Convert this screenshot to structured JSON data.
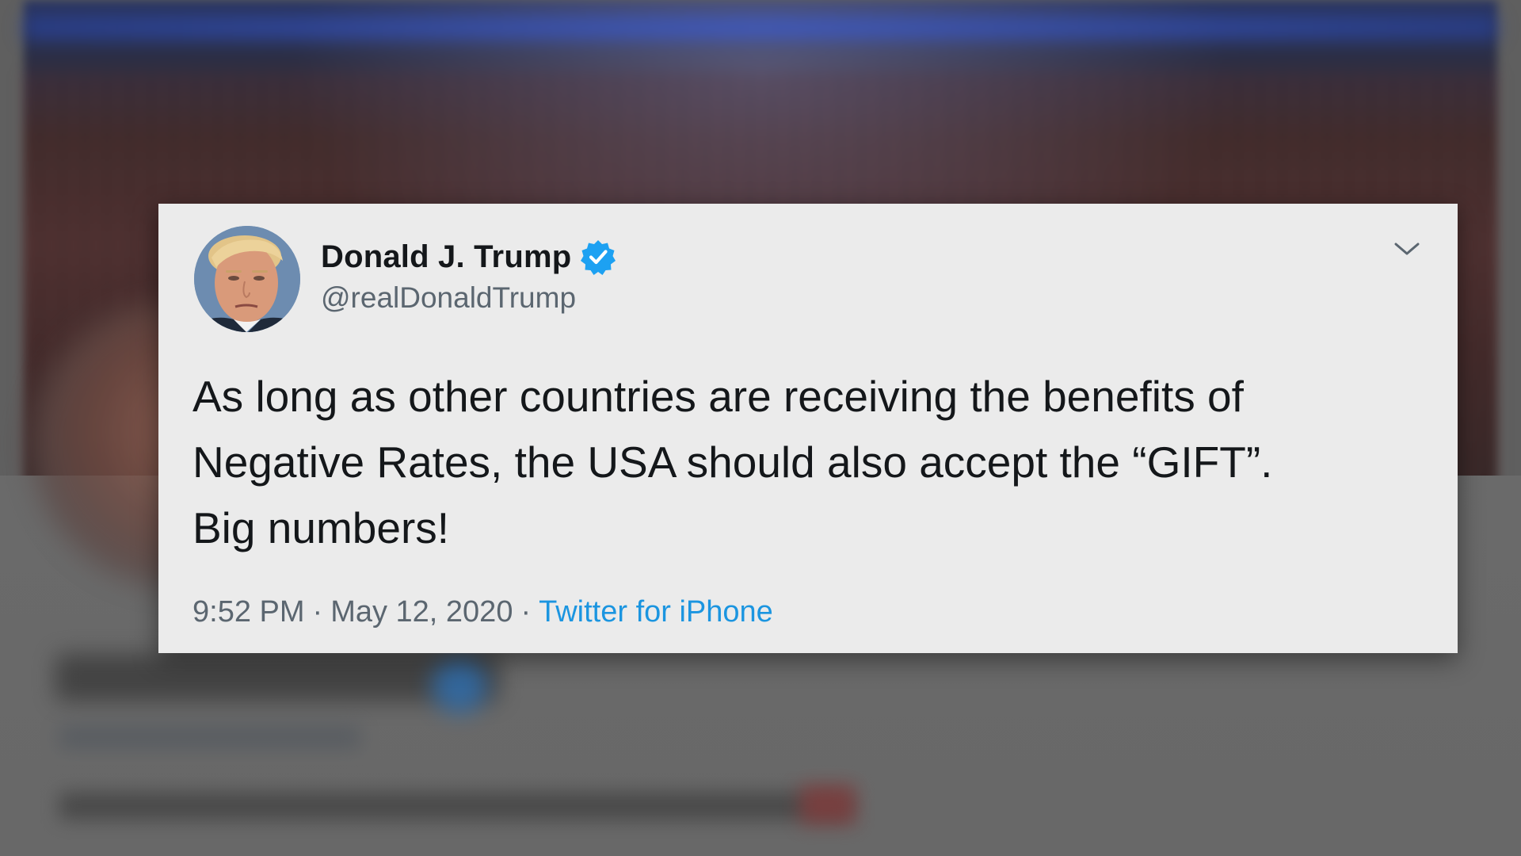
{
  "tweet": {
    "display_name": "Donald J. Trump",
    "handle": "@realDonaldTrump",
    "verified": true,
    "text_lines": [
      "As long as other countries are receiving the benefits of",
      "Negative Rates, the USA should also accept the “GIFT”.",
      "Big numbers!"
    ],
    "time": "9:52 PM",
    "separator": "·",
    "date": "May 12, 2020",
    "source": "Twitter for iPhone",
    "menu_icon": "chevron-down-icon",
    "avatar_icon": "profile-photo"
  },
  "colors": {
    "card_background": "#ebebeb",
    "text_primary": "#14171a",
    "text_secondary": "#5b6670",
    "link": "#1b95e0",
    "verified_badge": "#1da1f2"
  }
}
